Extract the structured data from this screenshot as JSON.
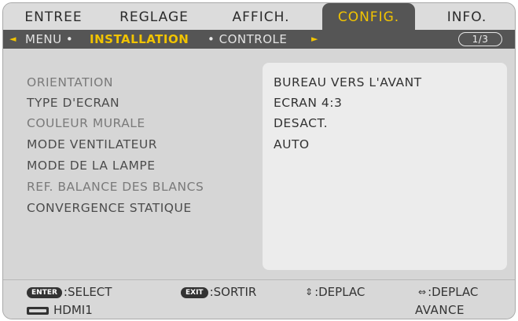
{
  "tabs": [
    "ENTREE",
    "REGLAGE",
    "AFFICH.",
    "CONFIG.",
    "INFO."
  ],
  "active_tab": "CONFIG.",
  "breadcrumbs": {
    "menu": "MENU",
    "installation": "INSTALLATION",
    "controle": "CONTROLE",
    "page": "1/3"
  },
  "items": [
    "ORIENTATION",
    "TYPE D'ECRAN",
    "COULEUR MURALE",
    "MODE VENTILATEUR",
    "MODE DE LA LAMPE",
    "REF. BALANCE DES BLANCS",
    "CONVERGENCE STATIQUE"
  ],
  "values": [
    "BUREAU VERS L'AVANT",
    "ECRAN 4:3",
    "DESACT.",
    "AUTO"
  ],
  "footer": {
    "enter_key": "ENTER",
    "select_label": ":SELECT",
    "exit_key": "EXIT",
    "exit_label": ":SORTIR",
    "updown_label": ":DEPLAC",
    "leftright_label": ":DEPLAC",
    "source": "HDMI1",
    "mode": "AVANCE"
  },
  "icons": {
    "left_arrow": "left-triangle-icon",
    "right_arrow": "right-triangle-icon",
    "updown": "up-down-arrows-icon",
    "leftright": "left-right-arrows-icon",
    "hdmi": "hdmi-connector-icon"
  },
  "colors": {
    "accent": "#f2c400",
    "bar": "#555555",
    "panel": "#ececec"
  }
}
